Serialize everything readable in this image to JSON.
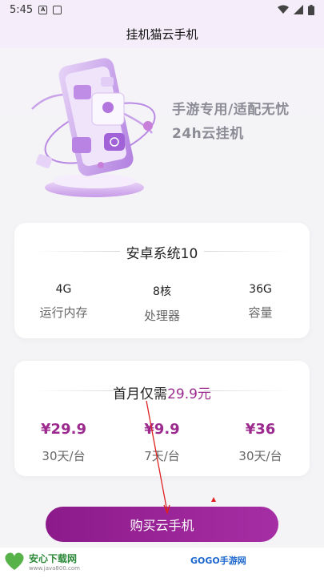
{
  "status_bar": {
    "time": "5:45"
  },
  "header": {
    "title": "挂机猫云手机"
  },
  "hero": {
    "slogan_line1": "手游专用/适配无忧",
    "slogan_line2": "24h云挂机"
  },
  "spec_card": {
    "title": "安卓系统10",
    "specs": [
      {
        "value": "4G",
        "label": "运行内存"
      },
      {
        "value": "8核",
        "label": "处理器"
      },
      {
        "value": "36G",
        "label": "容量"
      }
    ]
  },
  "price_card": {
    "title_prefix": "首月仅需",
    "title_price": "29.9元",
    "plans": [
      {
        "price": "¥29.9",
        "period": "30天/台"
      },
      {
        "price": "¥9.9",
        "period": "7天/台"
      },
      {
        "price": "¥36",
        "period": "30天/台"
      }
    ]
  },
  "buy_button": {
    "label": "购买云手机"
  },
  "watermark": {
    "left_name": "安心下载网",
    "left_url": "www.java800.com",
    "right_name": "GOGO手游网"
  },
  "colors": {
    "accent": "#9c2a8f",
    "button": "#9a239a",
    "header_bg": "#f5eefa"
  }
}
